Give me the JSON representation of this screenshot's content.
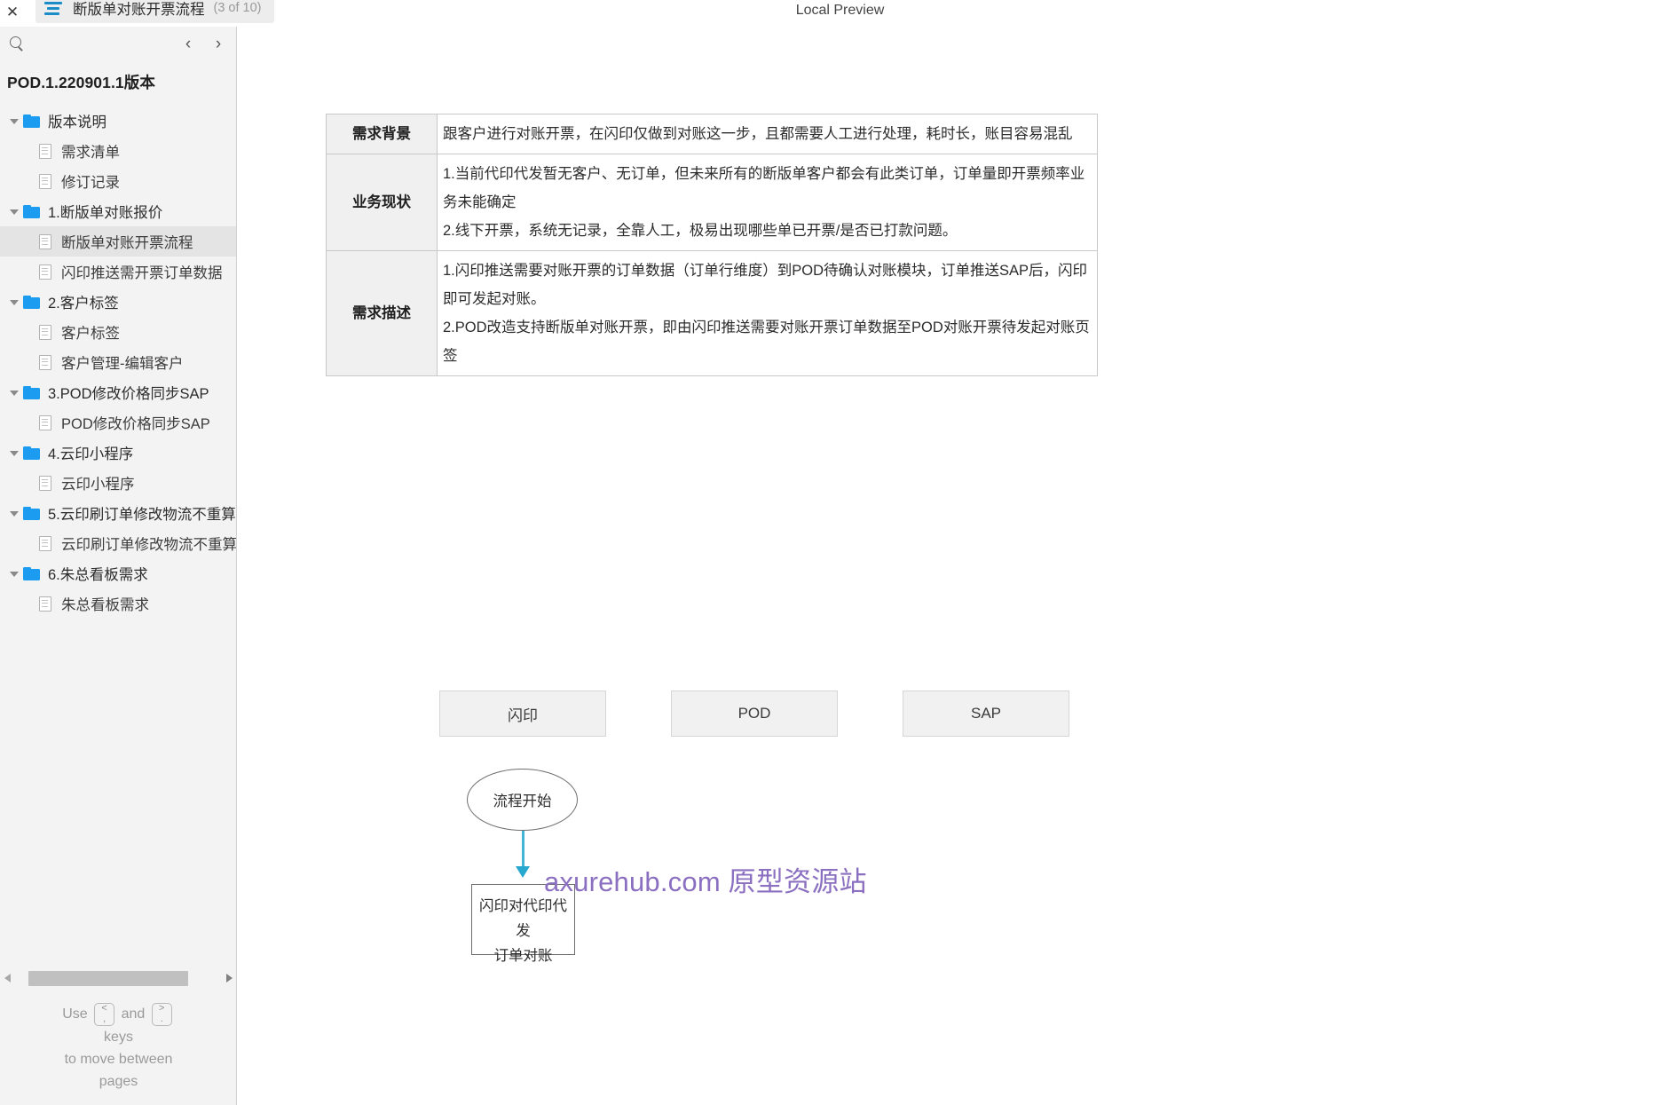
{
  "window": {
    "preview_label": "Local Preview",
    "close_icon": "close-icon"
  },
  "tab": {
    "icon": "outline-list-icon",
    "title": "断版单对账开票流程",
    "counter": "(3 of 10)"
  },
  "sidebar": {
    "search_icon": "search-icon",
    "prev_arrow": "‹",
    "next_arrow": "›",
    "version_title": "POD.1.220901.1版本",
    "tree": [
      {
        "type": "folder",
        "label": "版本说明",
        "expanded": true,
        "selected": false
      },
      {
        "type": "page",
        "label": "需求清单",
        "selected": false
      },
      {
        "type": "page",
        "label": "修订记录",
        "selected": false
      },
      {
        "type": "folder",
        "label": "1.断版单对账报价",
        "expanded": true,
        "selected": false
      },
      {
        "type": "page",
        "label": "断版单对账开票流程",
        "selected": true
      },
      {
        "type": "page",
        "label": "闪印推送需开票订单数据",
        "selected": false
      },
      {
        "type": "folder",
        "label": "2.客户标签",
        "expanded": true,
        "selected": false
      },
      {
        "type": "page",
        "label": "客户标签",
        "selected": false
      },
      {
        "type": "page",
        "label": "客户管理-编辑客户",
        "selected": false
      },
      {
        "type": "folder",
        "label": "3.POD修改价格同步SAP",
        "expanded": true,
        "selected": false
      },
      {
        "type": "page",
        "label": "POD修改价格同步SAP",
        "selected": false
      },
      {
        "type": "folder",
        "label": "4.云印小程序",
        "expanded": true,
        "selected": false
      },
      {
        "type": "page",
        "label": "云印小程序",
        "selected": false
      },
      {
        "type": "folder",
        "label": "5.云印刷订单修改物流不重算",
        "expanded": true,
        "selected": false
      },
      {
        "type": "page",
        "label": "云印刷订单修改物流不重算",
        "selected": false
      },
      {
        "type": "folder",
        "label": "6.朱总看板需求",
        "expanded": true,
        "selected": false
      },
      {
        "type": "page",
        "label": "朱总看板需求",
        "selected": false
      }
    ],
    "hint": {
      "use": "Use",
      "and": "and",
      "keys": "keys",
      "line3": "to move between",
      "line4": "pages",
      "key_left_top": "<",
      "key_left_bottom": ",",
      "key_right_top": ">",
      "key_right_bottom": "."
    }
  },
  "content": {
    "table": {
      "rows": [
        {
          "label": "需求背景",
          "lines": [
            "跟客户进行对账开票，在闪印仅做到对账这一步，且都需要人工进行处理，耗时长，账目容易混乱"
          ]
        },
        {
          "label": "业务现状",
          "lines": [
            "1.当前代印代发暂无客户、无订单，但未来所有的断版单客户都会有此类订单，订单量即开票频率业务未能确定",
            "2.线下开票，系统无记录，全靠人工，极易出现哪些单已开票/是否已打款问题。"
          ]
        },
        {
          "label": "需求描述",
          "lines": [
            "1.闪印推送需要对账开票的订单数据（订单行维度）到POD待确认对账模块，订单推送SAP后，闪印即可发起对账。",
            "2.POD改造支持断版单对账开票，即由闪印推送需要对账开票订单数据至POD对账开票待发起对账页签"
          ]
        }
      ]
    },
    "flow": {
      "lanes": [
        {
          "label": "闪印"
        },
        {
          "label": "POD"
        },
        {
          "label": "SAP"
        }
      ],
      "start_node": "流程开始",
      "first_process": "闪印对代印代发\n订单对账"
    },
    "watermark": "axurehub.com 原型资源站"
  },
  "colors": {
    "accent_blue": "#1b9cf0",
    "arrow_cyan": "#29a8cf",
    "watermark_purple": "#8b6fc0",
    "selection_grey": "#e4e4e4",
    "sidebar_bg": "#f3f3f3"
  }
}
